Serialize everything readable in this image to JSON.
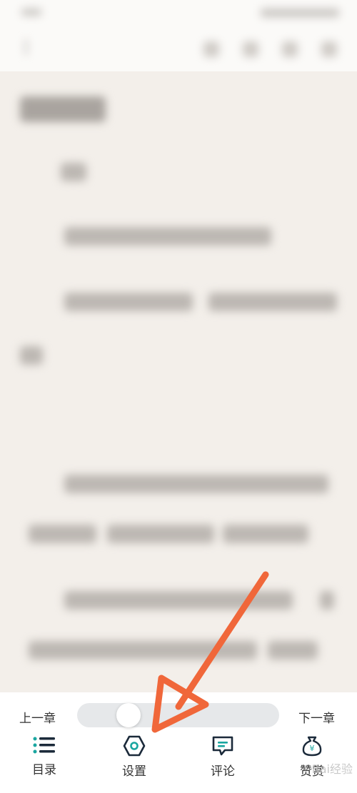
{
  "toolbar": {
    "prev_chapter": "上一章",
    "next_chapter": "下一章",
    "progress_fraction": 0.22,
    "nav": [
      {
        "label": "目录",
        "icon": "list-icon"
      },
      {
        "label": "设置",
        "icon": "settings-hex-icon"
      },
      {
        "label": "评论",
        "icon": "comment-icon"
      },
      {
        "label": "赞赏",
        "icon": "money-bag-icon"
      }
    ]
  },
  "watermark": "Bai经验",
  "colors": {
    "accent": "#1aa6a0",
    "arrow": "#f0673a",
    "page_bg": "#f3efea"
  }
}
